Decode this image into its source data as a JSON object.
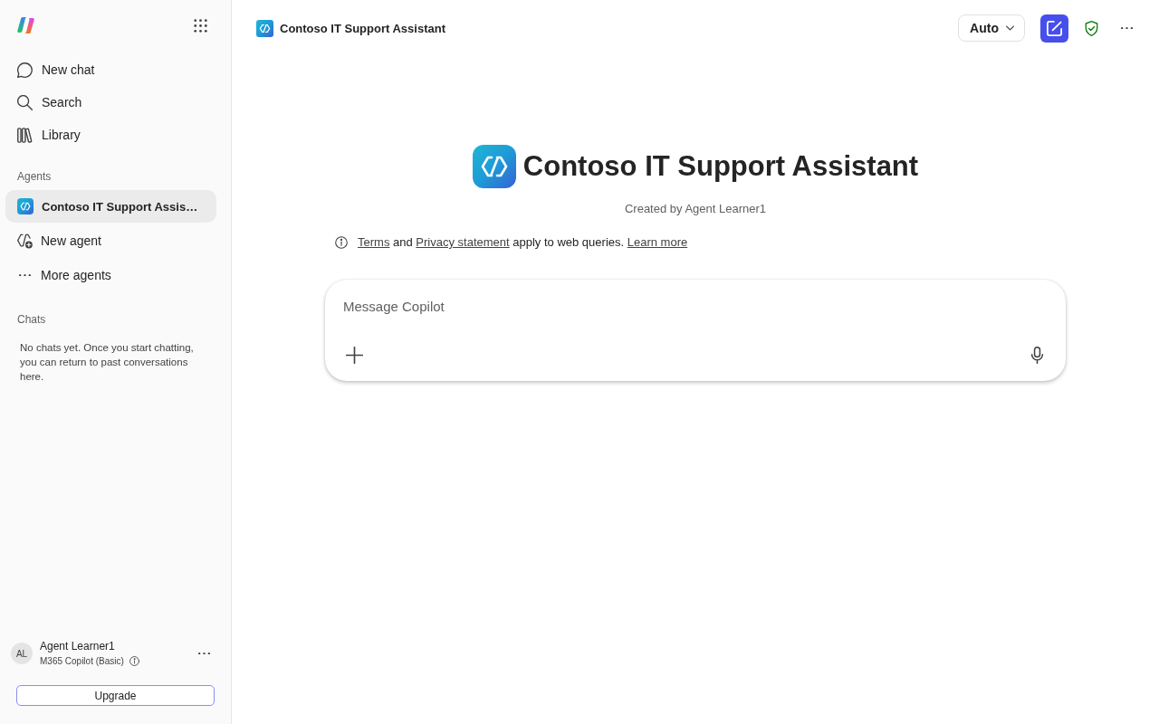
{
  "sidebar": {
    "nav": [
      {
        "label": "New chat",
        "kind": "chat"
      },
      {
        "label": "Search",
        "kind": "search"
      },
      {
        "label": "Library",
        "kind": "library"
      }
    ],
    "agents_heading": "Agents",
    "agents": [
      {
        "label": "Contoso IT Support Assis…",
        "kind": "agent",
        "selected": true
      },
      {
        "label": "New agent",
        "kind": "new-agent",
        "selected": false
      },
      {
        "label": "More agents",
        "kind": "more",
        "selected": false
      }
    ],
    "chats_heading": "Chats",
    "chats_empty": "No chats yet. Once you start chatting, you can return to past conversations here.",
    "user": {
      "initials": "AL",
      "name": "Agent Learner1",
      "plan": "M365 Copilot (Basic)"
    },
    "upgrade_button": "Upgrade"
  },
  "header": {
    "title": "Contoso IT Support Assistant",
    "mode": "Auto"
  },
  "hero": {
    "title": "Contoso IT Support Assistant",
    "subtitle": "Created by Agent Learner1",
    "notice": [
      {
        "kind": "link",
        "text": "Terms"
      },
      {
        "kind": "text",
        "text": " and "
      },
      {
        "kind": "link",
        "text": "Privacy statement"
      },
      {
        "kind": "text",
        "text": " apply to web queries. "
      },
      {
        "kind": "link",
        "text": "Learn more"
      }
    ]
  },
  "composer": {
    "placeholder": "Message Copilot"
  }
}
